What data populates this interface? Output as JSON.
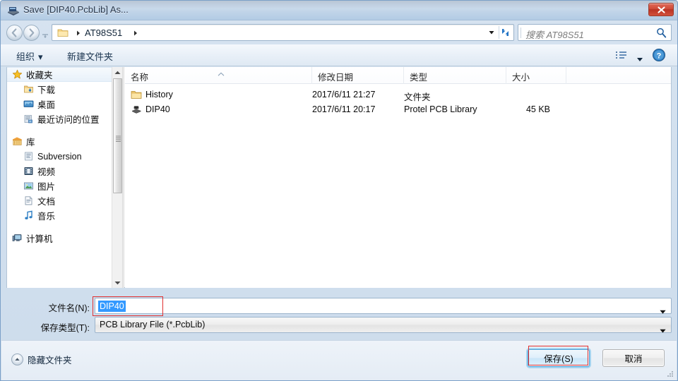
{
  "window": {
    "title": "Save [DIP40.PcbLib] As...",
    "title_icon": "pcblib-save-icon",
    "close_label": "×"
  },
  "nav": {
    "back_icon": "back-arrow-icon",
    "forward_icon": "forward-arrow-icon",
    "recent_icon": "recent-locations-icon",
    "breadcrumb_folder_icon": "folder-icon",
    "breadcrumb": "AT98S51",
    "address_dropdown_icon": "chevron-down-icon",
    "refresh_icon": "refresh-icon"
  },
  "search": {
    "placeholder": "搜索 AT98S51",
    "icon": "search-icon"
  },
  "commandbar": {
    "organize": "组织",
    "organize_caret": "▾",
    "new_folder": "新建文件夹",
    "view_mode_icon": "list-view-icon",
    "view_mode_caret_icon": "chevron-down-icon",
    "help_icon": "help-icon"
  },
  "sidebar": {
    "groups": [
      {
        "label": "收藏夹",
        "icon": "star-icon",
        "selected": true,
        "items": [
          {
            "label": "下载",
            "icon": "downloads-icon"
          },
          {
            "label": "桌面",
            "icon": "desktop-icon"
          },
          {
            "label": "最近访问的位置",
            "icon": "recent-places-icon"
          }
        ]
      },
      {
        "label": "库",
        "icon": "library-icon",
        "selected": false,
        "items": [
          {
            "label": "Subversion",
            "icon": "subversion-icon"
          },
          {
            "label": "视频",
            "icon": "videos-icon"
          },
          {
            "label": "图片",
            "icon": "pictures-icon"
          },
          {
            "label": "文档",
            "icon": "documents-icon"
          },
          {
            "label": "音乐",
            "icon": "music-icon"
          }
        ]
      },
      {
        "label": "计算机",
        "icon": "computer-icon",
        "selected": false,
        "items": []
      }
    ],
    "scroll_up_icon": "scroll-up-icon",
    "scroll_down_icon": "scroll-down-icon"
  },
  "filelist": {
    "columns": [
      {
        "key": "name",
        "label": "名称"
      },
      {
        "key": "date",
        "label": "修改日期"
      },
      {
        "key": "type",
        "label": "类型"
      },
      {
        "key": "size",
        "label": "大小"
      }
    ],
    "sort_indicator": "sort-ascending-icon",
    "rows": [
      {
        "name": "History",
        "icon": "folder-icon",
        "date": "2017/6/11 21:27",
        "type": "文件夹",
        "size": ""
      },
      {
        "name": "DIP40",
        "icon": "pcb-library-icon",
        "date": "2017/6/11 20:17",
        "type": "Protel PCB Library",
        "size": "45 KB"
      }
    ]
  },
  "form": {
    "filename_label": "文件名(N):",
    "filename_value": "DIP40",
    "filetype_label": "保存类型(T):",
    "filetype_value": "PCB Library File (*.PcbLib)",
    "dropdown_icon": "chevron-down-icon"
  },
  "footer": {
    "hide_folders_label": "隐藏文件夹",
    "hide_folders_icon": "chevron-up-circle-icon",
    "save_label": "保存(S)",
    "cancel_label": "取消",
    "resize_grip_icon": "resize-grip-icon"
  },
  "annotations": {
    "accent_color": "#e03030",
    "highlight_color": "#3399ff"
  }
}
